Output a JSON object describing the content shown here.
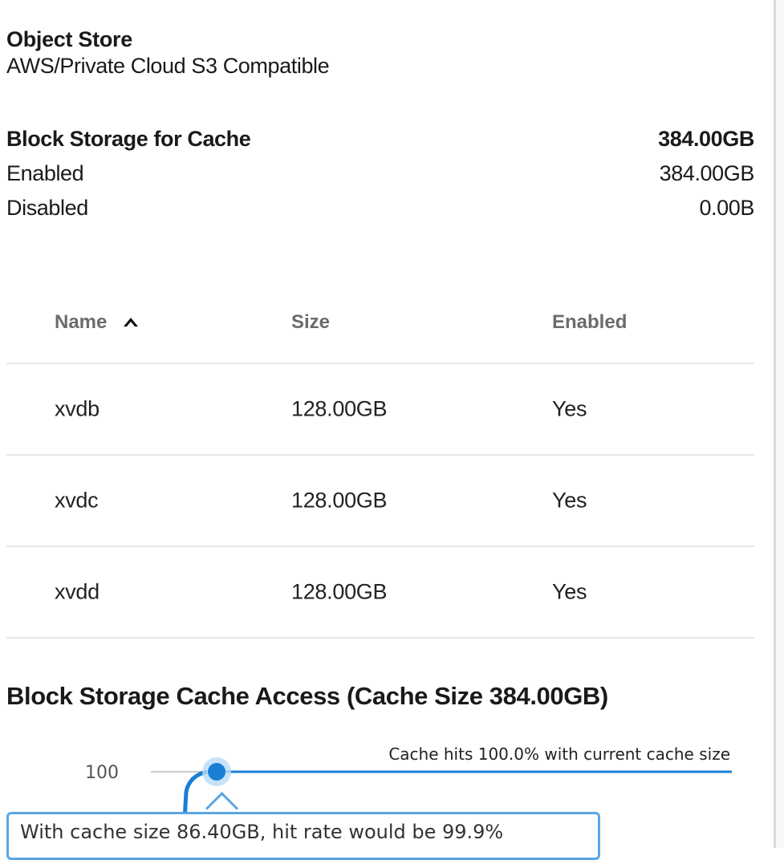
{
  "object_store": {
    "title": "Object Store",
    "type": "AWS/Private Cloud S3 Compatible"
  },
  "block_storage": {
    "title": "Block Storage for Cache",
    "total": "384.00GB",
    "rows": [
      {
        "label": "Enabled",
        "value": "384.00GB"
      },
      {
        "label": "Disabled",
        "value": "0.00B"
      }
    ]
  },
  "table": {
    "headers": {
      "name": "Name",
      "size": "Size",
      "enabled": "Enabled"
    },
    "sort": {
      "column": "name",
      "direction": "ascending",
      "icon": "arrow-up-icon"
    },
    "rows": [
      {
        "name": "xvdb",
        "size": "128.00GB",
        "enabled": "Yes"
      },
      {
        "name": "xvdc",
        "size": "128.00GB",
        "enabled": "Yes"
      },
      {
        "name": "xvdd",
        "size": "128.00GB",
        "enabled": "Yes"
      }
    ]
  },
  "cache_access": {
    "title": "Block Storage Cache Access (Cache Size 384.00GB)",
    "annotation": "Cache hits 100.0% with current cache size",
    "tooltip": "With cache size 86.40GB, hit rate would be 99.9%"
  },
  "chart_data": {
    "type": "line",
    "y_ticks": [
      "100"
    ],
    "series": [
      {
        "values": [
          {
            "cache_size_gb": 86.4,
            "hit_rate_pct": 99.9
          },
          {
            "cache_size_gb": 384.0,
            "hit_rate_pct": 100.0
          }
        ]
      }
    ],
    "highlighted_point": {
      "cache_size_gb": 86.4,
      "hit_rate_pct": 99.9
    },
    "colors": {
      "line": "#1a7fd4",
      "tooltip_border": "#5aa6e3"
    }
  }
}
